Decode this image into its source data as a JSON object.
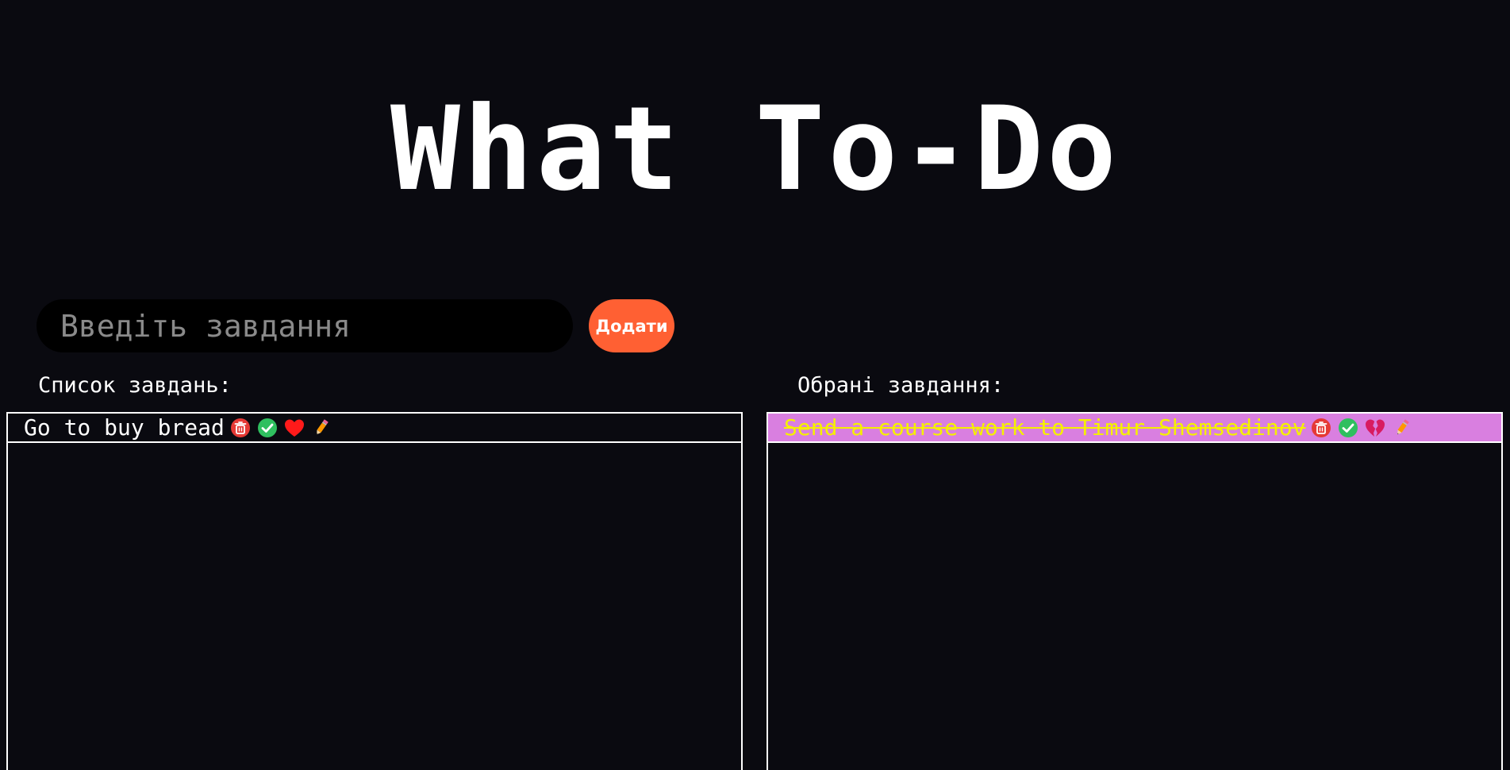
{
  "header": {
    "title": "What To-Do"
  },
  "input": {
    "placeholder": "Введіть завдання",
    "value": "",
    "add_label": "Додати"
  },
  "lists": {
    "tasks_label": "Список завдань:",
    "favorites_label": "Обрані завдання:",
    "tasks": [
      {
        "text": "Go to buy bread",
        "favorite": false,
        "icons": [
          "trash-icon",
          "check-icon",
          "heart-icon",
          "pencil-icon"
        ]
      }
    ],
    "favorites": [
      {
        "text": "Send a course work to Timur Shemsedinov",
        "favorite": true,
        "done": true,
        "icons": [
          "trash-icon",
          "check-icon",
          "broken-heart-icon",
          "pencil-icon"
        ]
      }
    ]
  },
  "colors": {
    "background": "#0a0a10",
    "accent": "#ff6033",
    "favorite_bg": "#d97fe0",
    "favorite_text": "#f5f000"
  }
}
